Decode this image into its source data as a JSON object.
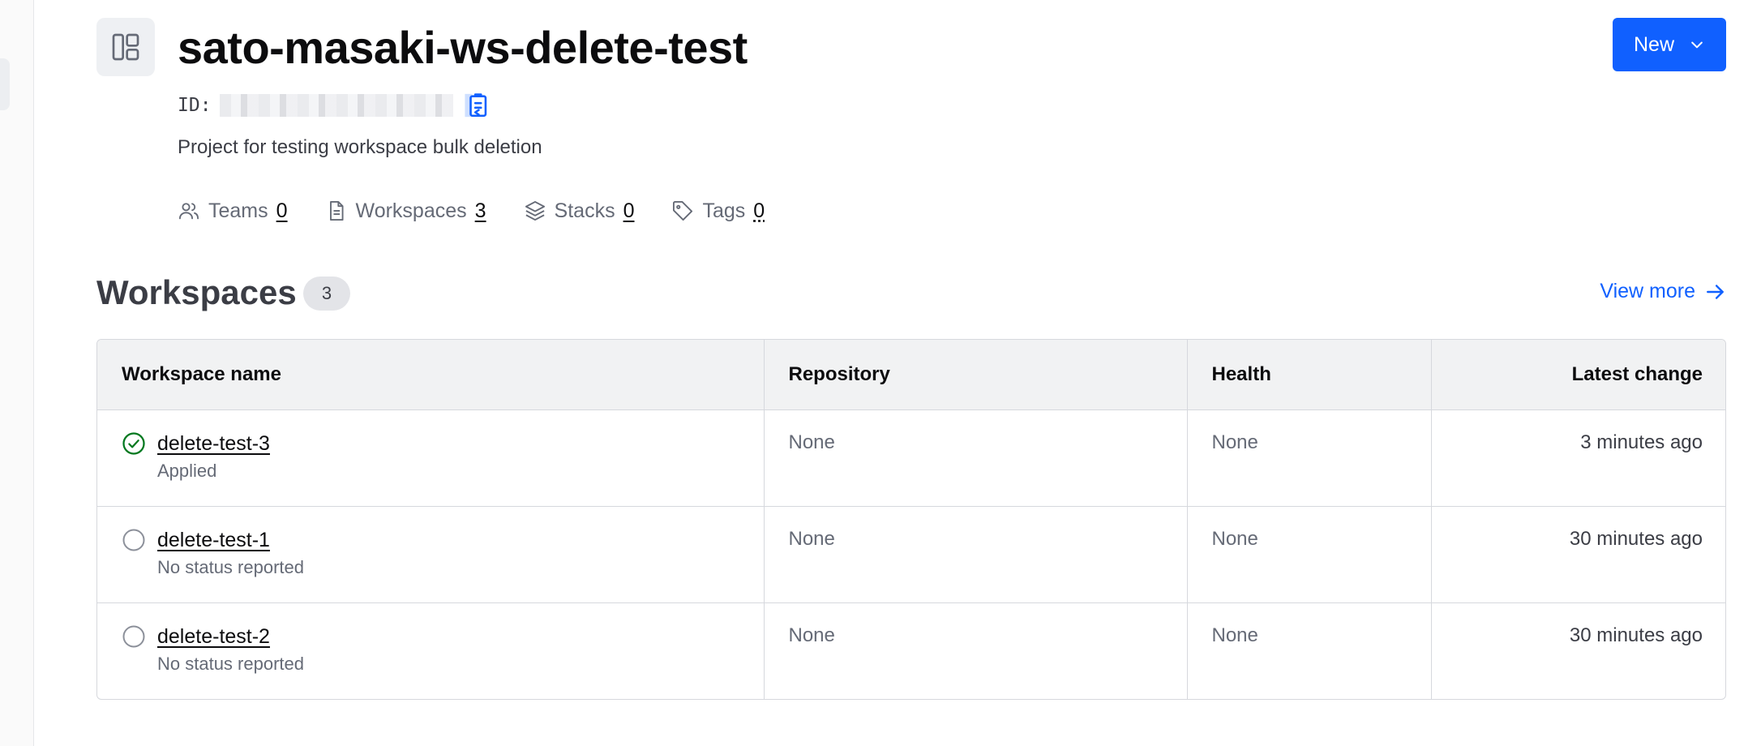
{
  "project": {
    "title": "sato-masaki-ws-delete-test",
    "id_label": "ID:",
    "description": "Project for testing workspace bulk deletion",
    "new_button_label": "New",
    "meta": [
      {
        "icon": "users-icon",
        "label": "Teams",
        "count": "0"
      },
      {
        "icon": "document-icon",
        "label": "Workspaces",
        "count": "3"
      },
      {
        "icon": "layers-icon",
        "label": "Stacks",
        "count": "0"
      },
      {
        "icon": "tag-icon",
        "label": "Tags",
        "count": "0"
      }
    ]
  },
  "workspaces_section": {
    "title": "Workspaces",
    "count": "3",
    "view_more_label": "View more",
    "columns": [
      "Workspace name",
      "Repository",
      "Health",
      "Latest change"
    ],
    "rows": [
      {
        "name": "delete-test-3",
        "status": "Applied",
        "status_icon": "check-circle-icon",
        "repository": "None",
        "health": "None",
        "latest_change": "3 minutes ago"
      },
      {
        "name": "delete-test-1",
        "status": "No status reported",
        "status_icon": "empty-circle-icon",
        "repository": "None",
        "health": "None",
        "latest_change": "30 minutes ago"
      },
      {
        "name": "delete-test-2",
        "status": "No status reported",
        "status_icon": "empty-circle-icon",
        "repository": "None",
        "health": "None",
        "latest_change": "30 minutes ago"
      }
    ]
  },
  "colors": {
    "primary": "#1060ff",
    "success": "#00781e",
    "text": "#0c0c0e",
    "muted": "#656a76",
    "border": "#d6d8dd",
    "header_bg": "#f1f2f3"
  }
}
